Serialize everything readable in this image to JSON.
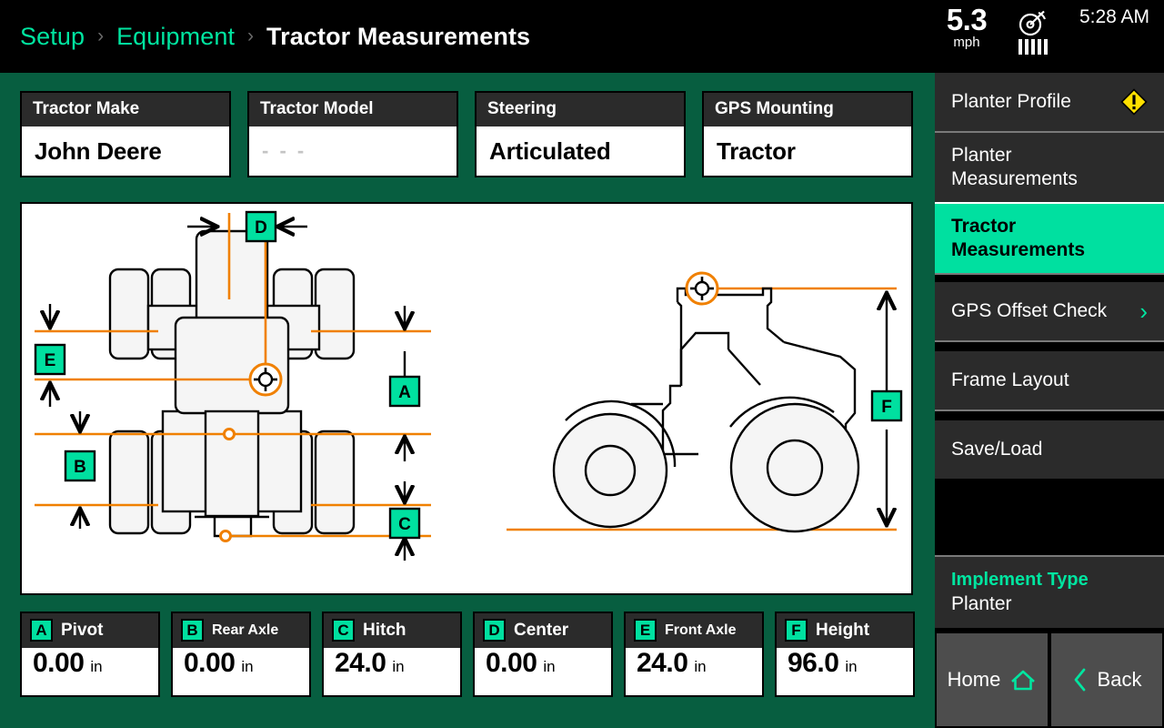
{
  "breadcrumb": {
    "items": [
      "Setup",
      "Equipment",
      "Tractor Measurements"
    ],
    "separator": "›"
  },
  "status": {
    "speed_value": "5.3",
    "speed_unit": "mph",
    "gps_icon": "satellite-dish-icon",
    "signal_bars": 5,
    "time": "5:28 AM"
  },
  "info_cards": [
    {
      "label": "Tractor Make",
      "value": "John Deere",
      "placeholder": false
    },
    {
      "label": "Tractor Model",
      "value": "- - -",
      "placeholder": true
    },
    {
      "label": "Steering",
      "value": "Articulated",
      "placeholder": false
    },
    {
      "label": "GPS Mounting",
      "value": "Tractor",
      "placeholder": false
    }
  ],
  "measurements": [
    {
      "badge": "A",
      "label": "Pivot",
      "value": "0.00",
      "unit": "in",
      "small": false
    },
    {
      "badge": "B",
      "label": "Rear Axle",
      "value": "0.00",
      "unit": "in",
      "small": true
    },
    {
      "badge": "C",
      "label": "Hitch",
      "value": "24.0",
      "unit": "in",
      "small": false
    },
    {
      "badge": "D",
      "label": "Center",
      "value": "0.00",
      "unit": "in",
      "small": false
    },
    {
      "badge": "E",
      "label": "Front Axle",
      "value": "24.0",
      "unit": "in",
      "small": true
    },
    {
      "badge": "F",
      "label": "Height",
      "value": "96.0",
      "unit": "in",
      "small": false
    }
  ],
  "diagram": {
    "view_top_label": "tractor-top-view",
    "view_side_label": "tractor-side-view",
    "dimension_badges": [
      "A",
      "B",
      "C",
      "D",
      "E",
      "F"
    ],
    "gps_marker_icon": "crosshair-target-icon",
    "pivot_marker_icon": "pivot-point-icon",
    "hitch_marker_icon": "hitch-point-icon"
  },
  "sidebar": {
    "items": [
      {
        "label": "Planter Profile",
        "active": false,
        "warning": true,
        "chevron": false
      },
      {
        "label": "Planter\nMeasurements",
        "active": false,
        "warning": false,
        "chevron": false
      },
      {
        "label": "Tractor\nMeasurements",
        "active": true,
        "warning": false,
        "chevron": false
      },
      {
        "label": "GPS Offset Check",
        "active": false,
        "warning": false,
        "chevron": true
      },
      {
        "label": "Frame Layout",
        "active": false,
        "warning": false,
        "chevron": false
      },
      {
        "label": "Save/Load",
        "active": false,
        "warning": false,
        "chevron": false
      }
    ],
    "implement": {
      "title": "Implement Type",
      "value": "Planter"
    },
    "nav": [
      {
        "label": "Home",
        "icon": "home-icon"
      },
      {
        "label": "Back",
        "icon": "chevron-left-icon"
      }
    ]
  },
  "colors": {
    "accent_teal": "#00E0A0",
    "panel_green": "#075E40",
    "dimension_orange": "#F08000",
    "warning_yellow": "#FFE000",
    "menu_gray": "#2b2b2b",
    "nav_gray": "#4d4d4d"
  }
}
